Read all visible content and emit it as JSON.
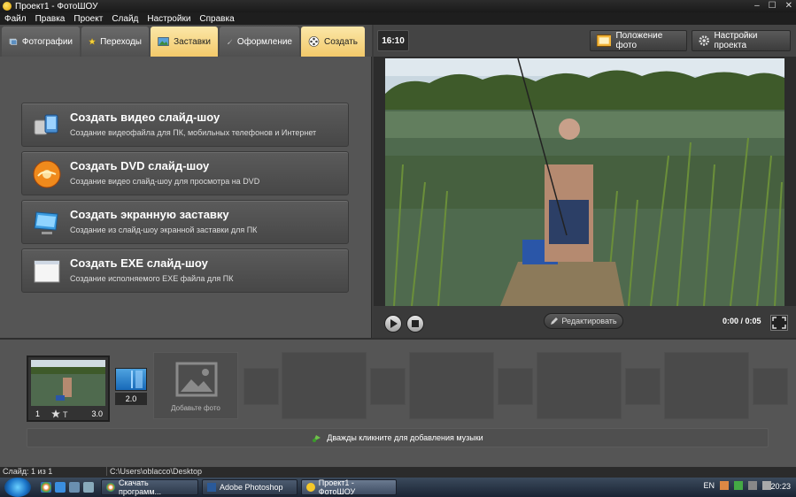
{
  "window": {
    "title": "Проект1 - ФотоШОУ",
    "controls": [
      "–",
      "☐",
      "✕"
    ]
  },
  "menu": [
    "Файл",
    "Правка",
    "Проект",
    "Слайд",
    "Настройки",
    "Справка"
  ],
  "tabs": [
    {
      "label": "Фотографии",
      "icon": "photos-icon"
    },
    {
      "label": "Переходы",
      "icon": "star-icon"
    },
    {
      "label": "Заставки",
      "icon": "image-icon"
    },
    {
      "label": "Оформление",
      "icon": "brush-icon"
    },
    {
      "label": "Создать",
      "icon": "film-reel-icon"
    }
  ],
  "create_options": [
    {
      "title": "Создать видео слайд-шоу",
      "subtitle": "Создание видеофайла для ПК, мобильных телефонов и Интернет",
      "icon": "video-device-icon"
    },
    {
      "title": "Создать DVD слайд-шоу",
      "subtitle": "Создание видео слайд-шоу для просмотра на DVD",
      "icon": "dvd-icon"
    },
    {
      "title": "Создать экранную заставку",
      "subtitle": "Создание из слайд-шоу экранной заставки для ПК",
      "icon": "monitor-icon"
    },
    {
      "title": "Создать EXE слайд-шоу",
      "subtitle": "Создание исполняемого EXE файла для ПК",
      "icon": "exe-window-icon"
    }
  ],
  "preview": {
    "aspect": "16:10",
    "position_button": "Положение фото",
    "settings_button": "Настройки проекта",
    "edit_button": "Редактировать",
    "time": "0:00 / 0:05"
  },
  "timeline": {
    "slide_number": "1",
    "slide_duration": "3.0",
    "transition_duration": "2.0",
    "add_photo": "Добавьте фото",
    "music_hint": "Дважды кликните для добавления музыки"
  },
  "status": {
    "slide": "Слайд: 1 из 1",
    "path": "C:\\Users\\oblacco\\Desktop"
  },
  "taskbar": {
    "tasks": [
      "Скачать программ...",
      "Adobe Photoshop",
      "Проект1 - ФотоШОУ"
    ],
    "lang": "EN",
    "time": "20:23"
  },
  "colors": {
    "active_tab": "#f3c96a",
    "panel": "#555555",
    "dark": "#2c2c2c"
  }
}
